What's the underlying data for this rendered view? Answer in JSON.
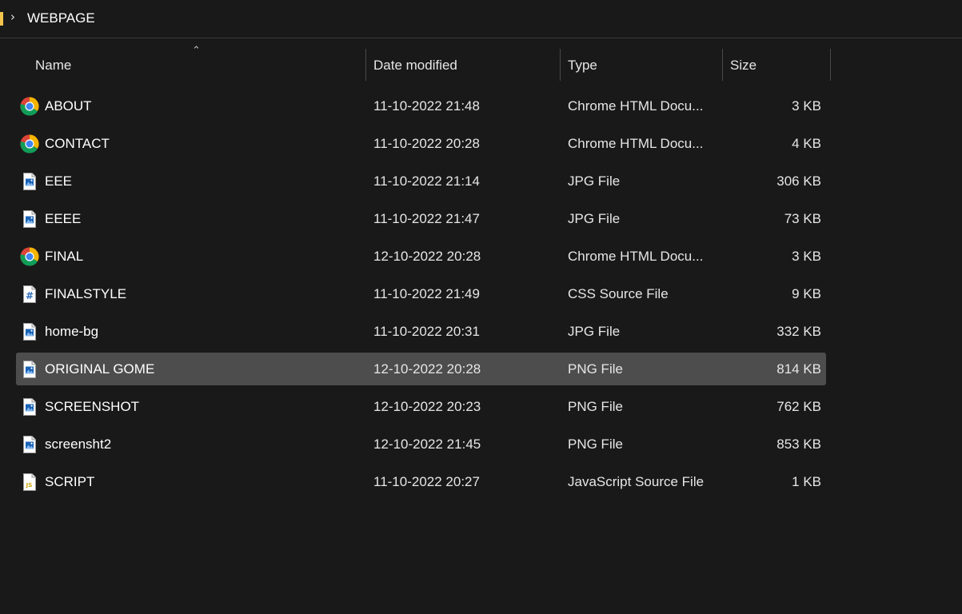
{
  "breadcrumb": {
    "folder": "WEBPAGE"
  },
  "columns": {
    "name": "Name",
    "date": "Date modified",
    "type": "Type",
    "size": "Size"
  },
  "files": [
    {
      "name": "ABOUT",
      "date": "11-10-2022 21:48",
      "type": "Chrome HTML Docu...",
      "size": "3 KB",
      "icon": "chrome-icon"
    },
    {
      "name": "CONTACT",
      "date": "11-10-2022 20:28",
      "type": "Chrome HTML Docu...",
      "size": "4 KB",
      "icon": "chrome-icon"
    },
    {
      "name": "EEE",
      "date": "11-10-2022 21:14",
      "type": "JPG File",
      "size": "306 KB",
      "icon": "image-file-icon"
    },
    {
      "name": "EEEE",
      "date": "11-10-2022 21:47",
      "type": "JPG File",
      "size": "73 KB",
      "icon": "image-file-icon"
    },
    {
      "name": "FINAL",
      "date": "12-10-2022 20:28",
      "type": "Chrome HTML Docu...",
      "size": "3 KB",
      "icon": "chrome-icon"
    },
    {
      "name": "FINALSTYLE",
      "date": "11-10-2022 21:49",
      "type": "CSS Source File",
      "size": "9 KB",
      "icon": "css-file-icon"
    },
    {
      "name": "home-bg",
      "date": "11-10-2022 20:31",
      "type": "JPG File",
      "size": "332 KB",
      "icon": "image-file-icon"
    },
    {
      "name": "ORIGINAL GOME",
      "date": "12-10-2022 20:28",
      "type": "PNG File",
      "size": "814 KB",
      "icon": "image-file-icon",
      "selected": true
    },
    {
      "name": "SCREENSHOT",
      "date": "12-10-2022 20:23",
      "type": "PNG File",
      "size": "762 KB",
      "icon": "image-file-icon"
    },
    {
      "name": "screensht2",
      "date": "12-10-2022 21:45",
      "type": "PNG File",
      "size": "853 KB",
      "icon": "image-file-icon"
    },
    {
      "name": "SCRIPT",
      "date": "11-10-2022 20:27",
      "type": "JavaScript Source File",
      "size": "1 KB",
      "icon": "js-file-icon"
    }
  ],
  "colors": {
    "background": "#191919",
    "selected_row": "#4d4d4d",
    "folder": "#f3c44c"
  }
}
